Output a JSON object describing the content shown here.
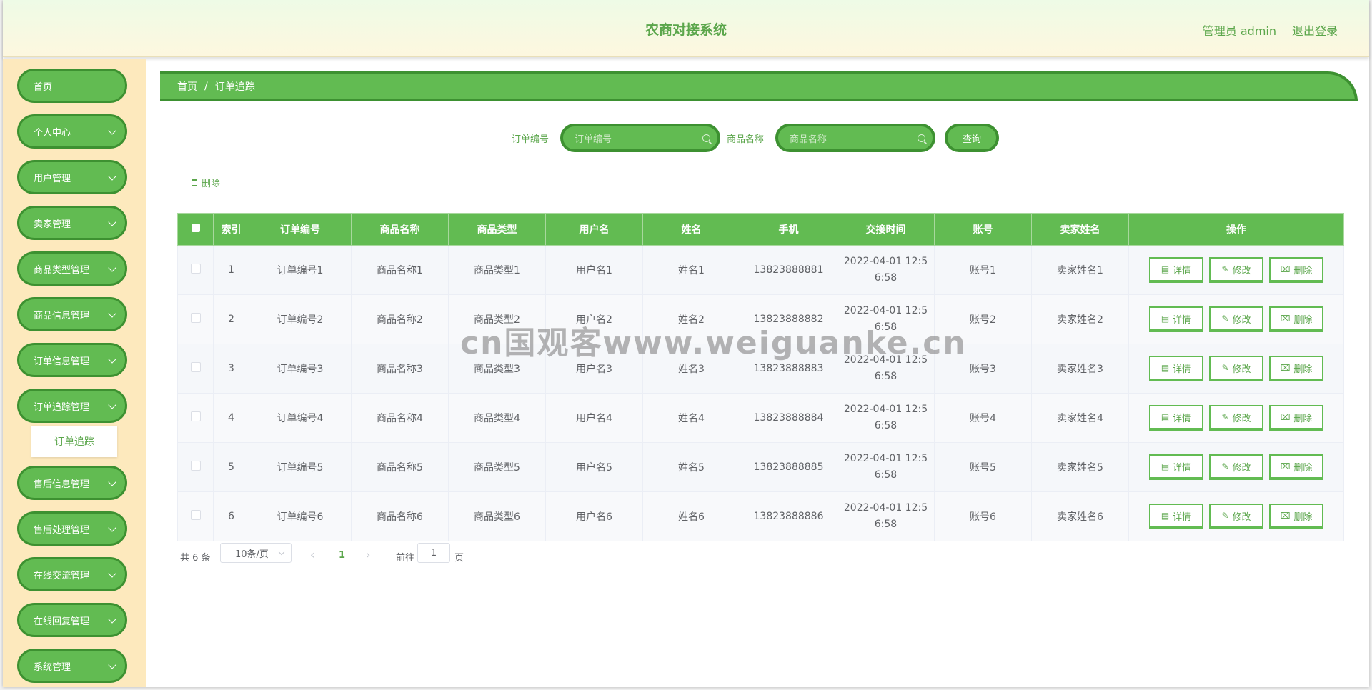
{
  "header": {
    "title": "农商对接系统",
    "admin_label": "管理员 admin",
    "logout": "退出登录"
  },
  "sidebar": {
    "items": [
      {
        "label": "首页",
        "has_children": false
      },
      {
        "label": "个人中心",
        "has_children": true
      },
      {
        "label": "用户管理",
        "has_children": true
      },
      {
        "label": "卖家管理",
        "has_children": true
      },
      {
        "label": "商品类型管理",
        "has_children": true
      },
      {
        "label": "商品信息管理",
        "has_children": true
      },
      {
        "label": "订单信息管理",
        "has_children": true
      },
      {
        "label": "订单追踪管理",
        "has_children": true
      },
      {
        "label": "售后信息管理",
        "has_children": true
      },
      {
        "label": "售后处理管理",
        "has_children": true
      },
      {
        "label": "在线交流管理",
        "has_children": true
      },
      {
        "label": "在线回复管理",
        "has_children": true
      },
      {
        "label": "系统管理",
        "has_children": true
      }
    ],
    "active_submenu": "订单追踪"
  },
  "breadcrumb": {
    "home": "首页",
    "separator": "/",
    "current": "订单追踪"
  },
  "search": {
    "order_label": "订单编号",
    "order_placeholder": "订单编号",
    "product_label": "商品名称",
    "product_placeholder": "商品名称",
    "query_button": "查询"
  },
  "toolbar": {
    "delete_label": "删除"
  },
  "table": {
    "columns": [
      "索引",
      "订单编号",
      "商品名称",
      "商品类型",
      "用户名",
      "姓名",
      "手机",
      "交接时间",
      "账号",
      "卖家姓名",
      "操作"
    ],
    "rows": [
      {
        "index": "1",
        "order_no": "订单编号1",
        "product": "商品名称1",
        "type": "商品类型1",
        "username": "用户名1",
        "name": "姓名1",
        "phone": "13823888881",
        "time_a": "2022-04-01 12:5",
        "time_b": "6:58",
        "account": "账号1",
        "seller": "卖家姓名1"
      },
      {
        "index": "2",
        "order_no": "订单编号2",
        "product": "商品名称2",
        "type": "商品类型2",
        "username": "用户名2",
        "name": "姓名2",
        "phone": "13823888882",
        "time_a": "2022-04-01 12:5",
        "time_b": "6:58",
        "account": "账号2",
        "seller": "卖家姓名2"
      },
      {
        "index": "3",
        "order_no": "订单编号3",
        "product": "商品名称3",
        "type": "商品类型3",
        "username": "用户名3",
        "name": "姓名3",
        "phone": "13823888883",
        "time_a": "2022-04-01 12:5",
        "time_b": "6:58",
        "account": "账号3",
        "seller": "卖家姓名3"
      },
      {
        "index": "4",
        "order_no": "订单编号4",
        "product": "商品名称4",
        "type": "商品类型4",
        "username": "用户名4",
        "name": "姓名4",
        "phone": "13823888884",
        "time_a": "2022-04-01 12:5",
        "time_b": "6:58",
        "account": "账号4",
        "seller": "卖家姓名4"
      },
      {
        "index": "5",
        "order_no": "订单编号5",
        "product": "商品名称5",
        "type": "商品类型5",
        "username": "用户名5",
        "name": "姓名5",
        "phone": "13823888885",
        "time_a": "2022-04-01 12:5",
        "time_b": "6:58",
        "account": "账号5",
        "seller": "卖家姓名5"
      },
      {
        "index": "6",
        "order_no": "订单编号6",
        "product": "商品名称6",
        "type": "商品类型6",
        "username": "用户名6",
        "name": "姓名6",
        "phone": "13823888886",
        "time_a": "2022-04-01 12:5",
        "time_b": "6:58",
        "account": "账号6",
        "seller": "卖家姓名6"
      }
    ],
    "actions": {
      "detail": "详情",
      "edit": "修改",
      "delete": "删除"
    }
  },
  "pagination": {
    "total": "共 6 条",
    "page_size": "10条/页",
    "prev": "‹",
    "current_page": "1",
    "next": "›",
    "goto_label": "前往",
    "goto_value": "1",
    "page_suffix": "页"
  },
  "watermark": "cn国观客www.weiguanke.cn",
  "colors": {
    "accent": "#62bb52",
    "accent_dark": "#3d9131",
    "text_green": "#5ba64b",
    "sidebar_bg": "#fde9bd"
  }
}
